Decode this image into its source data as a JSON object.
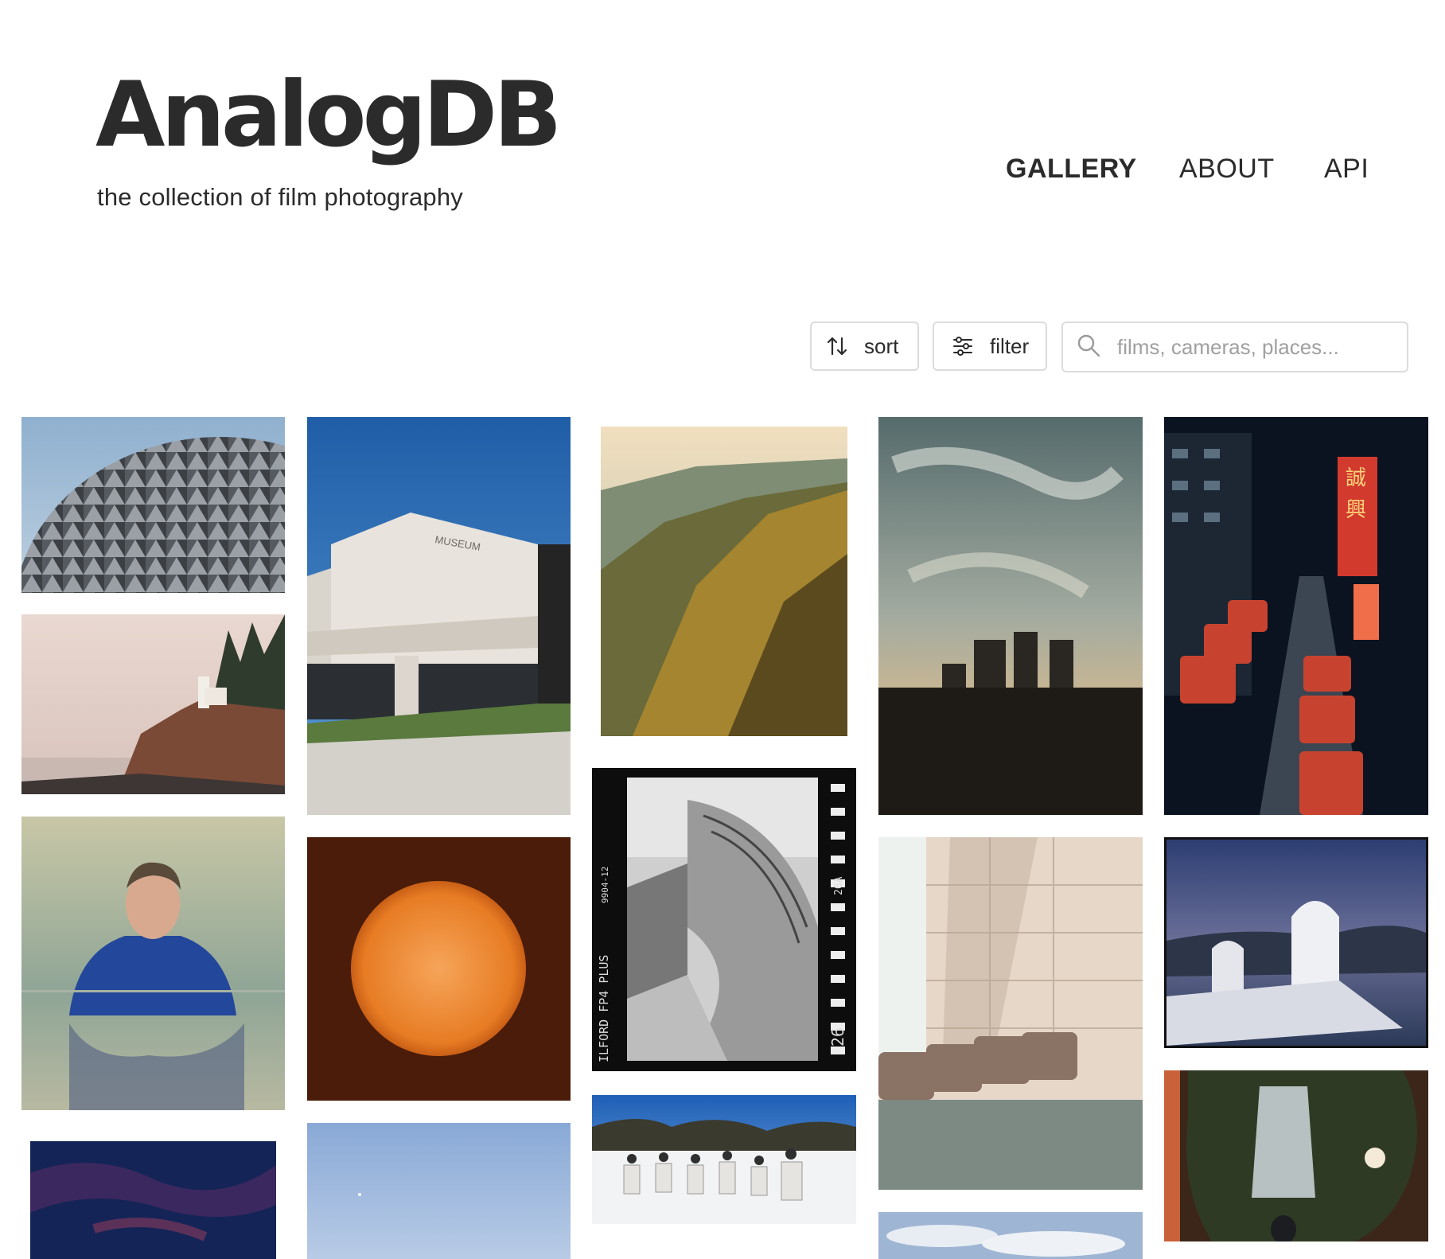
{
  "header": {
    "title": "AnalogDB",
    "subtitle": "the collection of film photography"
  },
  "nav": {
    "items": [
      {
        "label": "GALLERY",
        "active": true
      },
      {
        "label": "ABOUT",
        "active": false
      },
      {
        "label": "API",
        "active": false
      }
    ]
  },
  "toolbar": {
    "sort_label": "sort",
    "filter_label": "filter",
    "search_placeholder": "films, cameras, places...",
    "search_value": "",
    "icons": {
      "sort": "sort-arrows-icon",
      "filter": "sliders-icon",
      "search": "magnifier-icon"
    }
  },
  "gallery": {
    "photos": [
      {
        "subject": "geodesic-sphere"
      },
      {
        "subject": "lighthouse-cliff"
      },
      {
        "subject": "man-portrait"
      },
      {
        "subject": "dark-sky"
      },
      {
        "subject": "museum-building",
        "sign_text": "MUSEUM"
      },
      {
        "subject": "orange-sun"
      },
      {
        "subject": "pale-sky"
      },
      {
        "subject": "forested-mountains"
      },
      {
        "subject": "bw-walkway-film-strip",
        "film_edge_text": [
          "ILFORD FP4 PLUS",
          "9904-12",
          "26A",
          "26"
        ]
      },
      {
        "subject": "snow-group"
      },
      {
        "subject": "sky-city-skyline"
      },
      {
        "subject": "lobby-chairs"
      },
      {
        "subject": "clouds"
      },
      {
        "subject": "night-street-buses",
        "sign_text": [
          "誠",
          "興"
        ]
      },
      {
        "subject": "bell-tower-dusk"
      },
      {
        "subject": "waterfall-rocks"
      }
    ]
  }
}
